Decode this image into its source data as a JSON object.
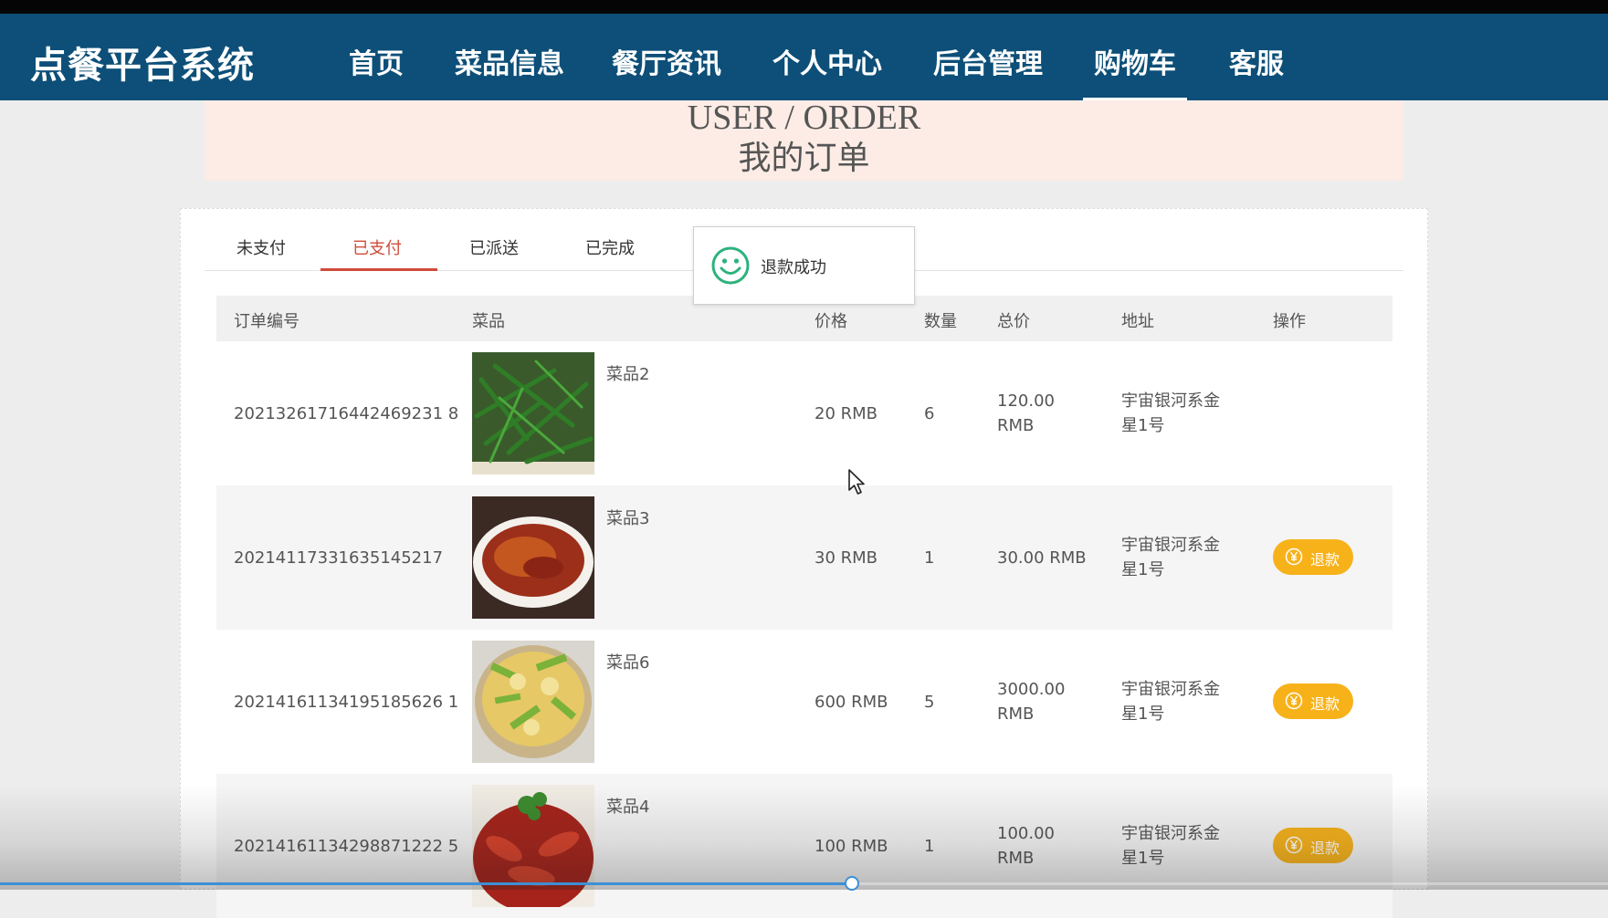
{
  "app": {
    "title": "点餐平台系统"
  },
  "nav": {
    "items": [
      {
        "label": "首页"
      },
      {
        "label": "菜品信息"
      },
      {
        "label": "餐厅资讯"
      },
      {
        "label": "个人中心"
      },
      {
        "label": "后台管理"
      },
      {
        "label": "购物车",
        "active": true
      },
      {
        "label": "客服"
      }
    ]
  },
  "banner": {
    "en_title": "USER / ORDER",
    "cn_title": "我的订单"
  },
  "tabs": [
    {
      "label": "未支付"
    },
    {
      "label": "已支付",
      "active": true
    },
    {
      "label": "已派送"
    },
    {
      "label": "已完成"
    }
  ],
  "toast": {
    "message": "退款成功",
    "icon": "smiley-icon"
  },
  "table": {
    "headers": [
      "订单编号",
      "菜品",
      "价格",
      "数量",
      "总价",
      "地址",
      "操作"
    ],
    "rows": [
      {
        "order_no": "20213261716442469231 8",
        "dish": "菜品2",
        "price": "20 RMB",
        "qty": "6",
        "total_l1": "120.00",
        "total_l2": "RMB",
        "addr_l1": "宇宙银河系金",
        "addr_l2": "星1号",
        "action": ""
      },
      {
        "order_no": "20214117331635145217",
        "dish": "菜品3",
        "price": "30 RMB",
        "qty": "1",
        "total_l1": "30.00 RMB",
        "total_l2": "",
        "addr_l1": "宇宙银河系金",
        "addr_l2": "星1号",
        "action": "退款"
      },
      {
        "order_no": "20214161134195185626 1",
        "dish": "菜品6",
        "price": "600 RMB",
        "qty": "5",
        "total_l1": "3000.00",
        "total_l2": "RMB",
        "addr_l1": "宇宙银河系金",
        "addr_l2": "星1号",
        "action": "退款"
      },
      {
        "order_no": "20214161134298871222 5",
        "dish": "菜品4",
        "price": "100 RMB",
        "qty": "1",
        "total_l1": "100.00",
        "total_l2": "RMB",
        "addr_l1": "宇宙银河系金",
        "addr_l2": "星1号",
        "action": "退款"
      }
    ]
  },
  "video": {
    "progress_fraction": 0.53
  },
  "colors": {
    "nav_bg": "#0d4f78",
    "accent": "#d04b3a",
    "refund": "#f7b21a",
    "toast_icon": "#2db27d"
  }
}
